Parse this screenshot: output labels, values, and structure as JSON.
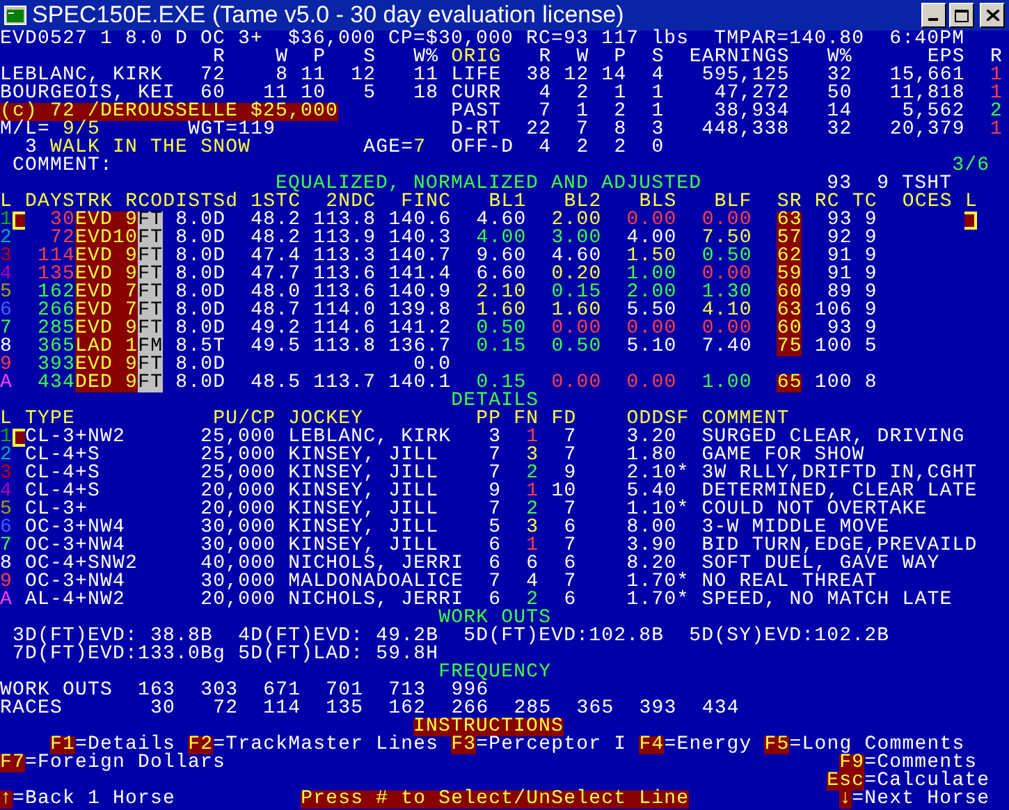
{
  "window": {
    "title": "SPEC150E.EXE (Tame v5.0 - 30 day evaluation license)"
  },
  "race_header": "EVD0527 1 8.0 D OC 3+  $36,000 CP=$30,000 RC=93 117 lbs  TMPAR=140.80  6:40PM",
  "connections": {
    "columns": [
      "R",
      "W",
      "P",
      "S",
      "W%"
    ],
    "rows": [
      {
        "name": "LEBLANC, KIRK",
        "values": [
          "72",
          "8",
          "11",
          "12",
          "11"
        ]
      },
      {
        "name": "BOURGEOIS, KEI",
        "values": [
          "60",
          "11",
          "10",
          "5",
          "18"
        ]
      }
    ]
  },
  "records": {
    "title": "ORIG",
    "columns": [
      "R",
      "W",
      "P",
      "S",
      "EARNINGS",
      "W%",
      "EPS",
      "R"
    ],
    "rows": [
      {
        "label": "LIFE",
        "values": [
          "38",
          "12",
          "14",
          "4",
          "595,125",
          "32",
          "15,661"
        ],
        "flag": {
          "text": "1",
          "color": "#ff4040"
        }
      },
      {
        "label": "CURR",
        "values": [
          "4",
          "2",
          "1",
          "1",
          "47,272",
          "50",
          "11,818"
        ],
        "flag": {
          "text": "1",
          "color": "#ff4040"
        }
      },
      {
        "label": "PAST",
        "values": [
          "7",
          "1",
          "2",
          "1",
          "38,934",
          "14",
          "5,562"
        ],
        "flag": {
          "text": "2",
          "color": "#40ff40"
        }
      },
      {
        "label": "D-RT",
        "values": [
          "22",
          "7",
          "8",
          "3",
          "448,338",
          "32",
          "20,379"
        ],
        "flag": {
          "text": "1",
          "color": "#ff4040"
        }
      },
      {
        "label": "OFF-D",
        "values": [
          "4",
          "2",
          "2",
          "0"
        ]
      }
    ]
  },
  "claim": "(c) 72 /DEROUSSELLE $25,000",
  "morning_line": {
    "label": "M/L=",
    "value": "9/5"
  },
  "weight": "WGT=119",
  "horse": {
    "number": "3",
    "name": "WALK IN THE SNOW"
  },
  "age": {
    "label": "AGE=",
    "value": "7"
  },
  "comment": "COMMENT:",
  "page": "3/6",
  "past_performances": {
    "title": "EQUALIZED, NORMALIZED AND ADJUSTED",
    "extras": [
      "93",
      "9",
      "TSHT"
    ],
    "columns": [
      "L",
      "DAYSTRK",
      "RCODISTSd",
      "1STC",
      "2NDC",
      "FINC",
      "BL1",
      "BL2",
      "BLS",
      "BLF",
      "SR",
      "RC",
      "TC",
      "OCES",
      "L"
    ],
    "rows": [
      {
        "id": "1",
        "color": "#00b000",
        "selected": true,
        "days": {
          "text": "30",
          "color": "#ff4040"
        },
        "track": "EVD 9",
        "surface": "FT",
        "distance": "8.0D",
        "first_call": "48.2",
        "second_call": "113.8",
        "final": "140.6",
        "figures": [
          {
            "text": "4.60",
            "color": "#ffffff"
          },
          {
            "text": "2.00",
            "color": "#ffff40"
          },
          {
            "text": "0.00",
            "color": "#ff4040"
          },
          {
            "text": "0.00",
            "color": "#ff4040"
          }
        ],
        "sr": "63",
        "rc": "93",
        "tc": "9"
      },
      {
        "id": "2",
        "color": "#00b0b0",
        "selected": false,
        "days": {
          "text": "72",
          "color": "#ff4040"
        },
        "track": "EVD10",
        "surface": "FT",
        "distance": "8.0D",
        "first_call": "48.2",
        "second_call": "113.9",
        "final": "140.3",
        "figures": [
          {
            "text": "4.00",
            "color": "#40ff40"
          },
          {
            "text": "3.00",
            "color": "#40ff40"
          },
          {
            "text": "4.00",
            "color": "#ffffff"
          },
          {
            "text": "7.50",
            "color": "#ffff40"
          }
        ],
        "sr": "57",
        "rc": "92",
        "tc": "9"
      },
      {
        "id": "3",
        "color": "#c00000",
        "selected": false,
        "days": {
          "text": "114",
          "color": "#ff4040"
        },
        "track": "EVD 9",
        "surface": "FT",
        "distance": "8.0D",
        "first_call": "47.4",
        "second_call": "113.3",
        "final": "140.7",
        "figures": [
          {
            "text": "9.60",
            "color": "#ffffff"
          },
          {
            "text": "4.60",
            "color": "#ffffff"
          },
          {
            "text": "1.50",
            "color": "#ffff40"
          },
          {
            "text": "0.50",
            "color": "#40ff40"
          }
        ],
        "sr": "62",
        "rc": "91",
        "tc": "9"
      },
      {
        "id": "4",
        "color": "#b000b0",
        "selected": false,
        "days": {
          "text": "135",
          "color": "#ff4040"
        },
        "track": "EVD 9",
        "surface": "FT",
        "distance": "8.0D",
        "first_call": "47.7",
        "second_call": "113.6",
        "final": "141.4",
        "figures": [
          {
            "text": "6.60",
            "color": "#ffffff"
          },
          {
            "text": "0.20",
            "color": "#ffff40"
          },
          {
            "text": "1.00",
            "color": "#40ff40"
          },
          {
            "text": "0.00",
            "color": "#ff4040"
          }
        ],
        "sr": "59",
        "rc": "91",
        "tc": "9"
      },
      {
        "id": "5",
        "color": "#b0a000",
        "selected": false,
        "days": {
          "text": "162",
          "color": "#40ff40"
        },
        "track": "EVD 7",
        "surface": "FT",
        "distance": "8.0D",
        "first_call": "48.0",
        "second_call": "113.6",
        "final": "140.9",
        "figures": [
          {
            "text": "2.10",
            "color": "#ffff40"
          },
          {
            "text": "0.15",
            "color": "#40ff40"
          },
          {
            "text": "2.00",
            "color": "#40ff40"
          },
          {
            "text": "1.30",
            "color": "#40ff40"
          }
        ],
        "sr": "60",
        "rc": "89",
        "tc": "9"
      },
      {
        "id": "6",
        "color": "#4060ff",
        "selected": false,
        "days": {
          "text": "266",
          "color": "#40ff40"
        },
        "track": "EVD 7",
        "surface": "FT",
        "distance": "8.0D",
        "first_call": "48.7",
        "second_call": "114.0",
        "final": "139.8",
        "figures": [
          {
            "text": "1.60",
            "color": "#ffff40"
          },
          {
            "text": "1.60",
            "color": "#ffff40"
          },
          {
            "text": "5.50",
            "color": "#ffffff"
          },
          {
            "text": "4.10",
            "color": "#ffff40"
          }
        ],
        "sr": "63",
        "rc": "106",
        "tc": "9"
      },
      {
        "id": "7",
        "color": "#40ff40",
        "selected": false,
        "days": {
          "text": "285",
          "color": "#40ff40"
        },
        "track": "EVD 9",
        "surface": "FT",
        "distance": "8.0D",
        "first_call": "49.2",
        "second_call": "114.6",
        "final": "141.2",
        "figures": [
          {
            "text": "0.50",
            "color": "#40ff40"
          },
          {
            "text": "0.00",
            "color": "#ff4040"
          },
          {
            "text": "0.00",
            "color": "#ff4040"
          },
          {
            "text": "0.00",
            "color": "#ff4040"
          }
        ],
        "sr": "60",
        "rc": "93",
        "tc": "9"
      },
      {
        "id": "8",
        "color": "#ffffff",
        "selected": false,
        "days": {
          "text": "365",
          "color": "#40ff40"
        },
        "track": "LAD 1",
        "surface": "FM",
        "distance": "8.5T",
        "first_call": "49.5",
        "second_call": "113.8",
        "final": "136.7",
        "figures": [
          {
            "text": "0.15",
            "color": "#40ff40"
          },
          {
            "text": "0.50",
            "color": "#40ff40"
          },
          {
            "text": "5.10",
            "color": "#ffffff"
          },
          {
            "text": "7.40",
            "color": "#ffffff"
          }
        ],
        "sr": "75",
        "rc": "100",
        "tc": "5"
      },
      {
        "id": "9",
        "color": "#ff4040",
        "selected": false,
        "days": {
          "text": "393",
          "color": "#40ff40"
        },
        "track": "EVD 9",
        "surface": "FT",
        "distance": "8.0D",
        "final": "0.0"
      },
      {
        "id": "A",
        "color": "#ff40ff",
        "selected": false,
        "days": {
          "text": "434",
          "color": "#40ff40"
        },
        "track": "DED 9",
        "surface": "FT",
        "distance": "8.0D",
        "first_call": "48.5",
        "second_call": "113.7",
        "final": "140.1",
        "figures": [
          {
            "text": "0.15",
            "color": "#40ff40"
          },
          {
            "text": "0.00",
            "color": "#ff4040"
          },
          {
            "text": "0.00",
            "color": "#ff4040"
          },
          {
            "text": "1.00",
            "color": "#40ff40"
          }
        ],
        "sr": "65",
        "rc": "100",
        "tc": "8"
      }
    ]
  },
  "details": {
    "title": "DETAILS",
    "columns": [
      "L",
      "TYPE",
      "PU/CP",
      "JOCKEY",
      "PP",
      "FN",
      "FD",
      "ODDSF",
      "COMMENT"
    ],
    "rows": [
      {
        "id": "1",
        "color": "#00b000",
        "selected": true,
        "type": "CL-3+NW2",
        "claim": "25,000",
        "jockey": "LEBLANC, KIRK",
        "pp": "3",
        "fn": {
          "text": "1",
          "color": "#ff4040"
        },
        "fd": "7",
        "odds": "3.20",
        "comment": "SURGED CLEAR, DRIVING"
      },
      {
        "id": "2",
        "color": "#00b0b0",
        "selected": false,
        "type": "CL-4+S",
        "claim": "25,000",
        "jockey": "KINSEY, JILL",
        "pp": "7",
        "fn": {
          "text": "3",
          "color": "#ffff40"
        },
        "fd": "7",
        "odds": "1.80",
        "comment": "GAME FOR SHOW"
      },
      {
        "id": "3",
        "color": "#c00000",
        "selected": false,
        "type": "CL-4+S",
        "claim": "25,000",
        "jockey": "KINSEY, JILL",
        "pp": "7",
        "fn": {
          "text": "2",
          "color": "#40ff40"
        },
        "fd": "9",
        "odds": "2.10*",
        "comment": "3W RLLY,DRIFTD IN,CGHT"
      },
      {
        "id": "4",
        "color": "#b000b0",
        "selected": false,
        "type": "CL-4+S",
        "claim": "20,000",
        "jockey": "KINSEY, JILL",
        "pp": "9",
        "fn": {
          "text": "1",
          "color": "#ff4040"
        },
        "fd": "10",
        "odds": "5.40",
        "comment": "DETERMINED, CLEAR LATE"
      },
      {
        "id": "5",
        "color": "#b0a000",
        "selected": false,
        "type": "CL-3+",
        "claim": "20,000",
        "jockey": "KINSEY, JILL",
        "pp": "7",
        "fn": {
          "text": "2",
          "color": "#40ff40"
        },
        "fd": "7",
        "odds": "1.10*",
        "comment": "COULD NOT OVERTAKE"
      },
      {
        "id": "6",
        "color": "#4060ff",
        "selected": false,
        "type": "OC-3+NW4",
        "claim": "30,000",
        "jockey": "KINSEY, JILL",
        "pp": "5",
        "fn": {
          "text": "3",
          "color": "#ffff40"
        },
        "fd": "6",
        "odds": "8.00",
        "comment": "3-W MIDDLE MOVE"
      },
      {
        "id": "7",
        "color": "#40ff40",
        "selected": false,
        "type": "OC-3+NW4",
        "claim": "30,000",
        "jockey": "KINSEY, JILL",
        "pp": "6",
        "fn": {
          "text": "1",
          "color": "#ff4040"
        },
        "fd": "7",
        "odds": "3.90",
        "comment": "BID TURN,EDGE,PREVAILD"
      },
      {
        "id": "8",
        "color": "#ffffff",
        "selected": false,
        "type": "OC-4+SNW2",
        "claim": "40,000",
        "jockey": "NICHOLS, JERRI",
        "pp": "6",
        "fn": {
          "text": "6",
          "color": "#ffffff"
        },
        "fd": "6",
        "odds": "8.20",
        "comment": "SOFT DUEL, GAVE WAY"
      },
      {
        "id": "9",
        "color": "#ff4040",
        "selected": false,
        "type": "OC-3+NW4",
        "claim": "30,000",
        "jockey": "MALDONADOALICE",
        "pp": "7",
        "fn": {
          "text": "4",
          "color": "#ffffff"
        },
        "fd": "7",
        "odds": "1.70*",
        "comment": "NO REAL THREAT"
      },
      {
        "id": "A",
        "color": "#ff40ff",
        "selected": false,
        "type": "AL-4+NW2",
        "claim": "20,000",
        "jockey": "NICHOLS, JERRI",
        "pp": "6",
        "fn": {
          "text": "2",
          "color": "#40ff40"
        },
        "fd": "6",
        "odds": "1.70*",
        "comment": "SPEED, NO MATCH LATE"
      }
    ]
  },
  "workouts": {
    "title": "WORK OUTS",
    "items": [
      "3D(FT)EVD: 38.8B",
      "4D(FT)EVD: 49.2B",
      "5D(FT)EVD:102.8B",
      "5D(SY)EVD:102.2B",
      "7D(FT)EVD:133.0Bg",
      "5D(FT)LAD: 59.8H"
    ]
  },
  "frequency": {
    "title": "FREQUENCY",
    "rows": [
      {
        "label": "WORK OUTS",
        "values": [
          "163",
          "303",
          "671",
          "701",
          "713",
          "996"
        ]
      },
      {
        "label": "RACES",
        "values": [
          "30",
          "72",
          "114",
          "135",
          "162",
          "266",
          "285",
          "365",
          "393",
          "434"
        ]
      }
    ]
  },
  "instructions": {
    "title": "INSTRUCTIONS",
    "keys": [
      {
        "key": "F1",
        "label": "=Details"
      },
      {
        "key": "F2",
        "label": "=TrackMaster Lines"
      },
      {
        "key": "F3",
        "label": "=Perceptor I"
      },
      {
        "key": "F4",
        "label": "=Energy"
      },
      {
        "key": "F5",
        "label": "=Long Comments"
      }
    ],
    "extra_keys": [
      {
        "key": "F7",
        "label": "=Foreign Dollars"
      },
      {
        "key": "F9",
        "label": "=Comments"
      },
      {
        "key": "Esc",
        "label": "=Calculate"
      }
    ],
    "navigation": [
      {
        "key": "↑",
        "label": "=Back 1 Horse"
      },
      {
        "key": "↓",
        "label": "=Next Horse"
      }
    ],
    "prompt": "Press # to Select/UnSelect Line"
  }
}
